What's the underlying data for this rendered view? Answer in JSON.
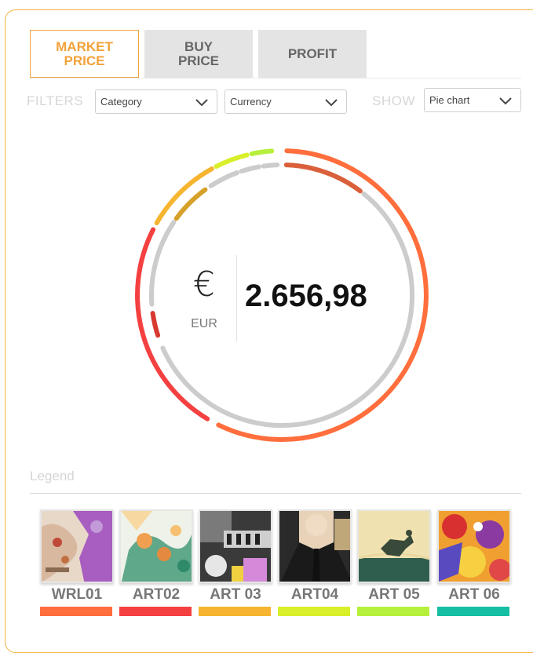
{
  "tabs": [
    {
      "label": "MARKET\nPRICE",
      "active": true
    },
    {
      "label": "BUY\nPRICE",
      "active": false
    },
    {
      "label": "PROFIT",
      "active": false
    }
  ],
  "filters": {
    "label": "FILTERS",
    "category": "Category",
    "currency": "Currency",
    "show_label": "SHOW",
    "show_value": "Pie chart"
  },
  "total": {
    "symbol": "€",
    "code": "EUR",
    "amount": "2.656,98"
  },
  "legend": {
    "title": "Legend",
    "items": [
      {
        "label": "WRL01",
        "color": "#ff6e3c"
      },
      {
        "label": "ART02",
        "color": "#f44040"
      },
      {
        "label": "ART 03",
        "color": "#f6b530"
      },
      {
        "label": "ART04",
        "color": "#d8ef2a"
      },
      {
        "label": "ART 05",
        "color": "#b6f03c"
      },
      {
        "label": "ART 06",
        "color": "#16bfa3"
      }
    ]
  },
  "colors": {
    "accent": "#f2a23a",
    "ring_gray": "#cccccc"
  },
  "icons": {
    "dropdown": "chevron-down-icon"
  }
}
